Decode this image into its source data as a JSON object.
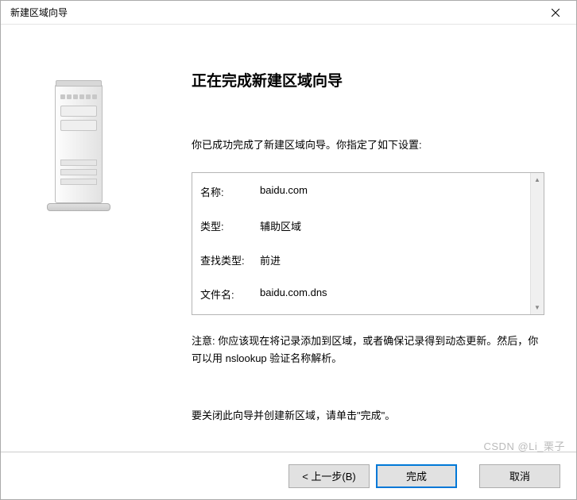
{
  "window": {
    "title": "新建区域向导"
  },
  "main": {
    "heading": "正在完成新建区域向导",
    "intro": "你已成功完成了新建区域向导。你指定了如下设置:",
    "settings": {
      "name_label": "名称:",
      "name_value": "baidu.com",
      "type_label": "类型:",
      "type_value": "辅助区域",
      "lookup_label": "查找类型:",
      "lookup_value": "前进",
      "file_label": "文件名:",
      "file_value": "baidu.com.dns"
    },
    "note": "注意: 你应该现在将记录添加到区域，或者确保记录得到动态更新。然后，你可以用 nslookup 验证名称解析。",
    "instruction": "要关闭此向导并创建新区域，请单击\"完成\"。"
  },
  "buttons": {
    "back": "< 上一步(B)",
    "finish": "完成",
    "cancel": "取消"
  },
  "watermark": "CSDN @Li_栗子"
}
